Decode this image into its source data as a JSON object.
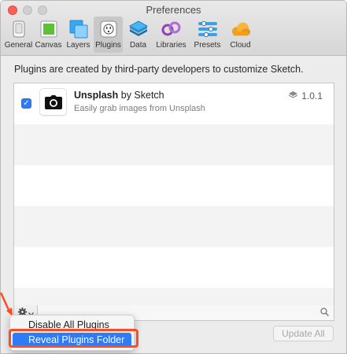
{
  "window": {
    "title": "Preferences"
  },
  "toolbar": {
    "tabs": [
      {
        "label": "General",
        "icon": "phone-icon"
      },
      {
        "label": "Canvas",
        "icon": "canvas-icon"
      },
      {
        "label": "Layers",
        "icon": "layers-icon"
      },
      {
        "label": "Plugins",
        "icon": "plug-icon",
        "active": true
      },
      {
        "label": "Data",
        "icon": "data-icon"
      },
      {
        "label": "Libraries",
        "icon": "libraries-icon"
      },
      {
        "label": "Presets",
        "icon": "presets-icon"
      },
      {
        "label": "Cloud",
        "icon": "cloud-icon"
      }
    ]
  },
  "intro_text": "Plugins are created by third-party developers to customize Sketch.",
  "plugins": [
    {
      "name": "Unsplash",
      "by": "by Sketch",
      "description": "Easily grab images from Unsplash",
      "version": "1.0.1",
      "enabled": true
    }
  ],
  "update_button": "Update All",
  "menu": {
    "items": [
      "Disable All Plugins",
      "Reveal Plugins Folder"
    ],
    "highlighted": "Reveal Plugins Folder"
  },
  "colors": {
    "accent": "#2f7bf5",
    "annotation": "#ff4b24"
  }
}
